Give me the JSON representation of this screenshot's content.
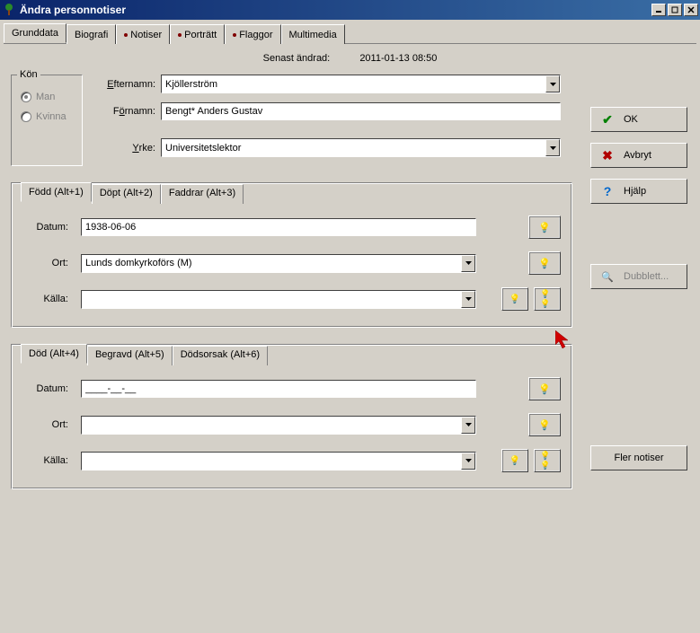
{
  "window": {
    "title": "Ändra personnotiser"
  },
  "tabs": {
    "grunddata": "Grunddata",
    "biografi": "Biografi",
    "notiser": "Notiser",
    "portratt": "Porträtt",
    "flaggor": "Flaggor",
    "multimedia": "Multimedia"
  },
  "modified": {
    "label": "Senast ändrad:",
    "value": "2011-01-13 08:50"
  },
  "gender": {
    "legend": "Kön",
    "man": "Man",
    "kvinna": "Kvinna"
  },
  "person": {
    "efternamn_label": "Efternamn:",
    "efternamn": "Kjöllerström",
    "fornamn_label": "Förnamn:",
    "fornamn": "Bengt* Anders Gustav",
    "yrke_label": "Yrke:",
    "yrke": "Universitetslektor"
  },
  "birth": {
    "tabs": {
      "fodd": "Född   (Alt+1)",
      "dopt": "Döpt   (Alt+2)",
      "faddrar": "Faddrar   (Alt+3)"
    },
    "datum_label": "Datum:",
    "datum": "1938-06-06",
    "ort_label": "Ort:",
    "ort": "Lunds domkyrkoförs (M)",
    "kalla_label": "Källa:",
    "kalla": ""
  },
  "death": {
    "tabs": {
      "dod": "Död   (Alt+4)",
      "begravd": "Begravd   (Alt+5)",
      "dodsorsak": "Dödsorsak   (Alt+6)"
    },
    "datum_label": "Datum:",
    "datum": "____-__-__",
    "ort_label": "Ort:",
    "ort": "",
    "kalla_label": "Källa:",
    "kalla": ""
  },
  "buttons": {
    "ok": "OK",
    "avbryt": "Avbryt",
    "hjalp": "Hjälp",
    "dubblett": "Dubblett...",
    "fler": "Fler notiser"
  }
}
